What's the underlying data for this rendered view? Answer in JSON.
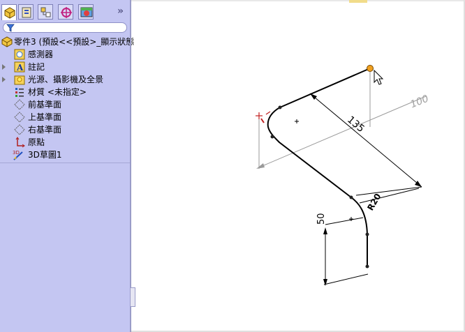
{
  "panel": {
    "tabs": [
      {
        "name": "feature-manager-tab"
      },
      {
        "name": "property-manager-tab"
      },
      {
        "name": "configuration-manager-tab"
      },
      {
        "name": "dimxpert-manager-tab"
      },
      {
        "name": "display-manager-tab"
      }
    ],
    "more_label": "»",
    "tree": {
      "root_label": "零件3  (預設<<預設>_顯示狀態",
      "items": [
        {
          "label": "感測器",
          "icon": "sensors-icon"
        },
        {
          "label": "註記",
          "icon": "annotations-icon"
        },
        {
          "label": "光源、攝影機及全景",
          "icon": "lights-cameras-icon"
        },
        {
          "label": "材質 <未指定>",
          "icon": "material-icon"
        },
        {
          "label": "前基準面",
          "icon": "plane-icon"
        },
        {
          "label": "上基準面",
          "icon": "plane-icon"
        },
        {
          "label": "右基準面",
          "icon": "plane-icon"
        },
        {
          "label": "原點",
          "icon": "origin-icon"
        },
        {
          "label": "3D草圖1",
          "icon": "3d-sketch-icon"
        }
      ]
    }
  },
  "sketch": {
    "dimensions": {
      "length_100": "100",
      "length_135": "135",
      "length_50": "50",
      "radius_label": "R20"
    }
  }
}
